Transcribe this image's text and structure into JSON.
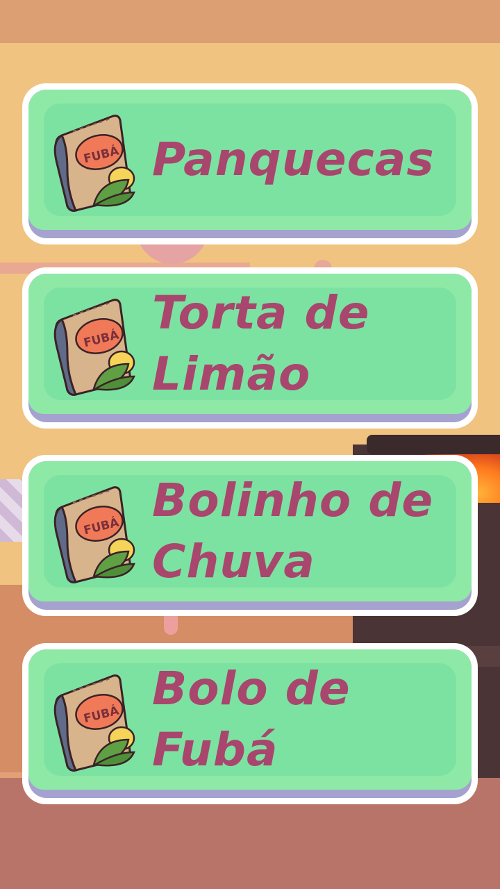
{
  "menu": {
    "items": [
      {
        "label": "Panquecas",
        "icon": "fuba-bag-icon",
        "icon_text": "FUBÁ"
      },
      {
        "label": "Torta de Limão",
        "icon": "fuba-bag-icon",
        "icon_text": "FUBÁ"
      },
      {
        "label": "Bolinho de Chuva",
        "icon": "fuba-bag-icon",
        "icon_text": "FUBÁ"
      },
      {
        "label": "Bolo de Fubá",
        "icon": "fuba-bag-icon",
        "icon_text": "FUBÁ"
      }
    ]
  },
  "colors": {
    "button_face": "#8ee9a6",
    "button_inner": "#7ce2a1",
    "button_shadow": "#a5a2cf",
    "label_text": "#a8466e",
    "background_wall": "#f0c381"
  }
}
